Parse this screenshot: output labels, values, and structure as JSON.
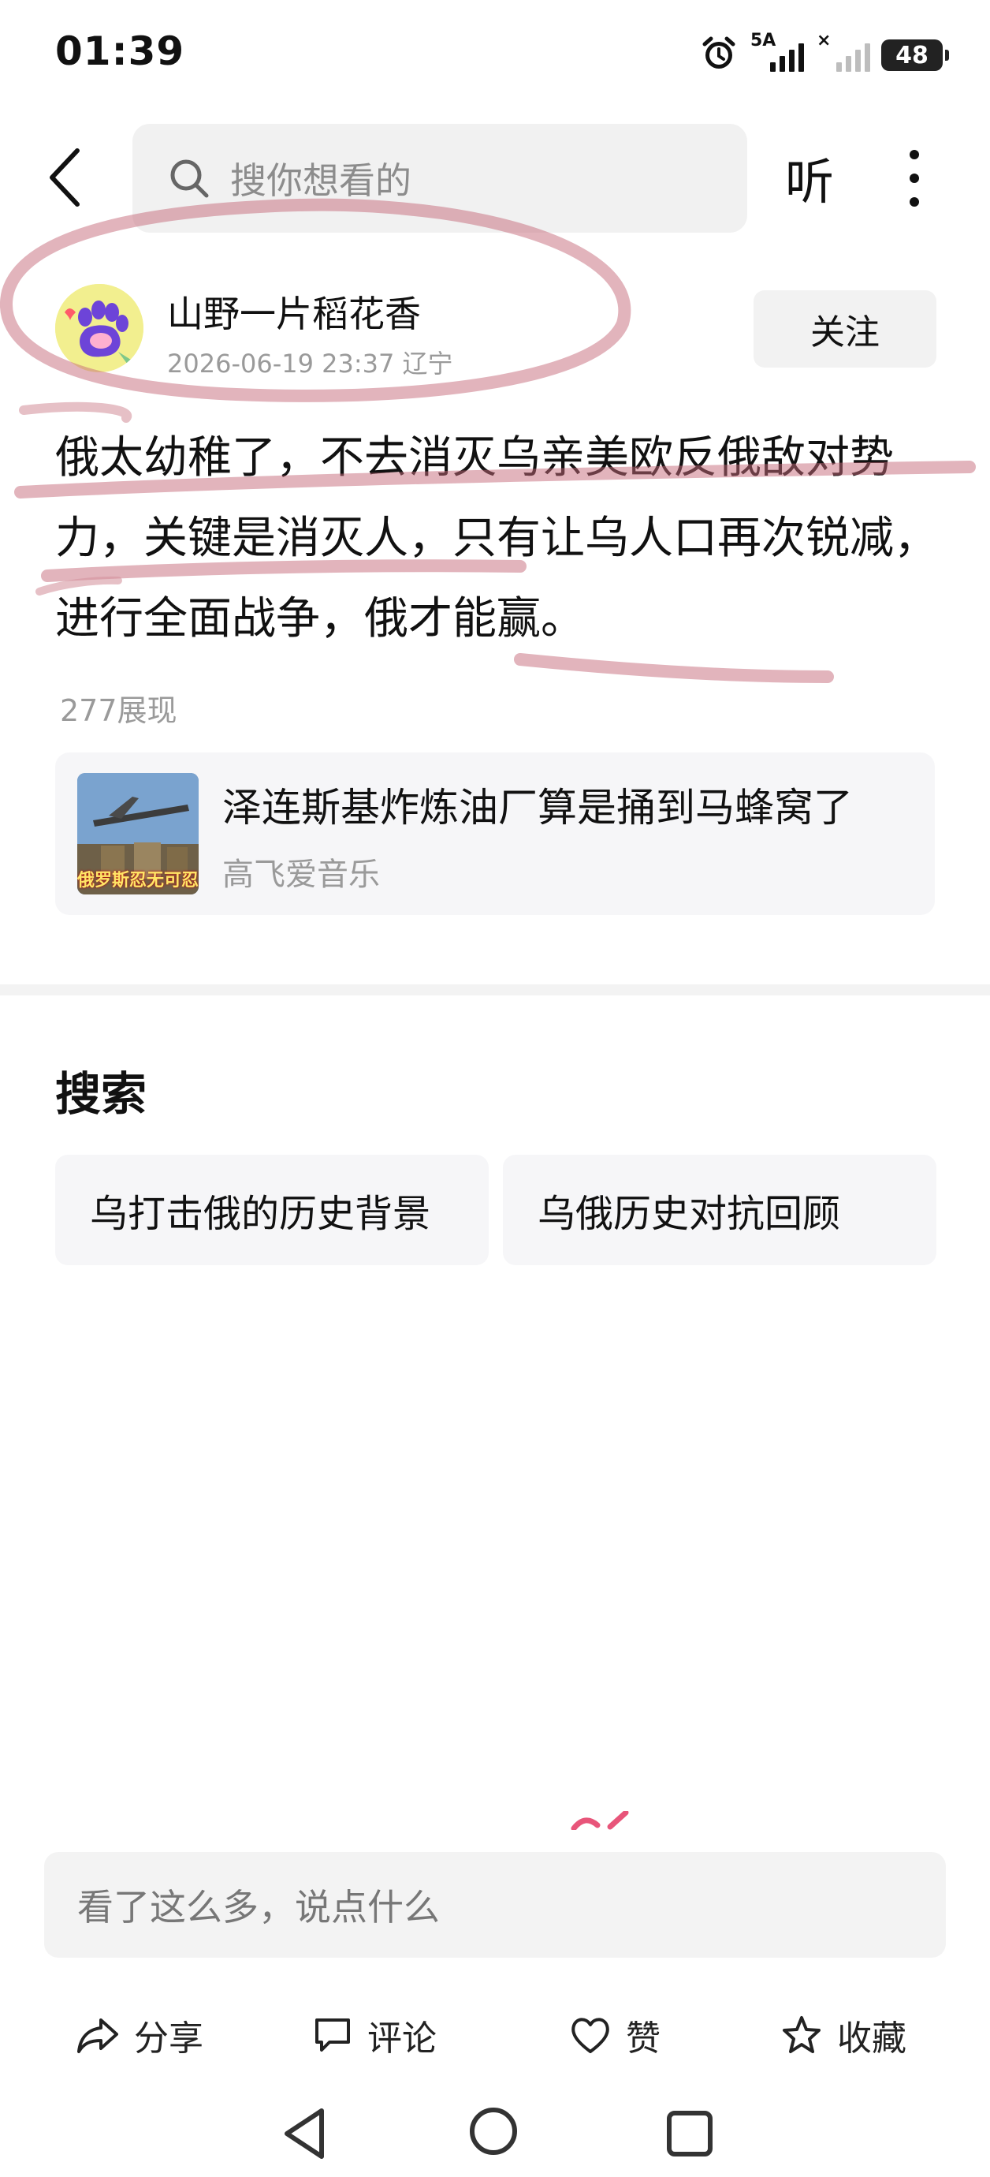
{
  "status_bar": {
    "time": "01:39",
    "signal1_label": "5A",
    "signal2_label": "×",
    "battery": "48"
  },
  "header": {
    "search_placeholder": "搜你想看的",
    "listen_label": "听",
    "icons": [
      "back-arrow-icon",
      "search-icon",
      "more-icon"
    ]
  },
  "post": {
    "author": "山野一片稻花香",
    "datetime_location": "2026-06-19 23:37 辽宁",
    "follow_label": "关注",
    "text": "俄太幼稚了，不去消灭乌亲美欧反俄敌对势力，关键是消灭人，只有让乌人口再次锐减，进行全面战争，俄才能赢。",
    "views": "277展现"
  },
  "linked_card": {
    "title": "泽连斯基炸炼油厂算是捅到马蜂窝了",
    "source": "高飞爱音乐",
    "thumb_caption": "俄罗斯忍无可忍"
  },
  "search_section": {
    "title": "搜索",
    "suggestions": [
      "乌打击俄的历史背景",
      "乌俄历史对抗回顾"
    ]
  },
  "comment_box": {
    "placeholder": "看了这么多，说点什么"
  },
  "actions": {
    "share": "分享",
    "comment": "评论",
    "like": "赞",
    "favorite": "收藏"
  },
  "colors": {
    "annotation_red": "#c0394b",
    "accent_background": "#f3f3f3"
  }
}
